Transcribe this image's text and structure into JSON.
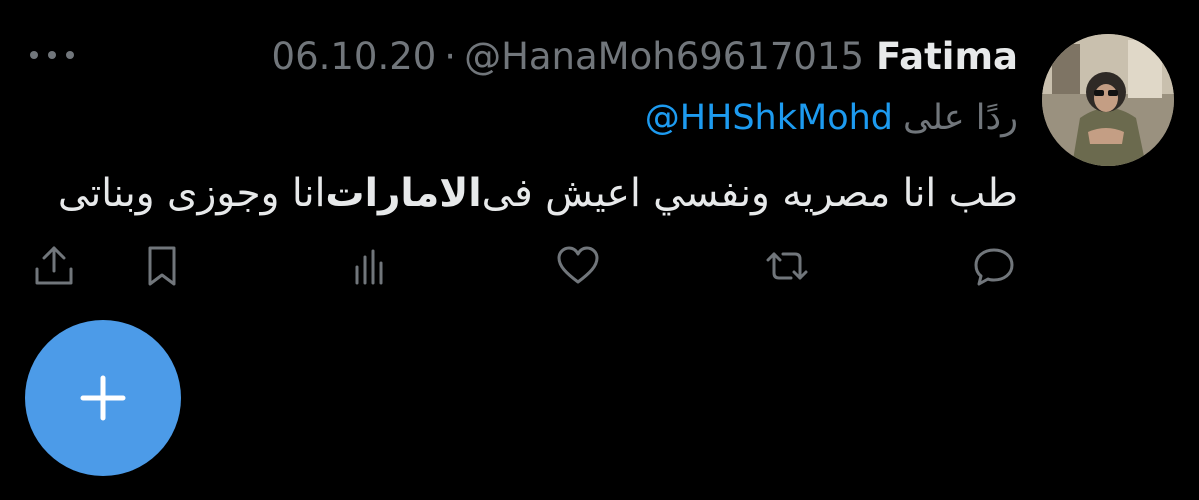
{
  "tweet": {
    "author_name": "Fatima",
    "handle": "@HanaMoh69617015",
    "separator": "·",
    "date": "06.10.20",
    "reply_prefix": "ردًا على",
    "reply_mention": "@HHShkMohd",
    "text_before": "طب انا مصريه ونفسي اعيش فى ",
    "text_bold": "الامارات",
    "text_after": " انا وجوزى وبناتى"
  },
  "actions": [
    {
      "name": "reply",
      "icon": "reply-icon"
    },
    {
      "name": "retweet",
      "icon": "retweet-icon"
    },
    {
      "name": "like",
      "icon": "heart-icon"
    },
    {
      "name": "analytics",
      "icon": "analytics-icon"
    },
    {
      "name": "bookmark",
      "icon": "bookmark-icon"
    },
    {
      "name": "share",
      "icon": "share-icon"
    }
  ],
  "colors": {
    "background": "#000000",
    "text": "#e7e9ea",
    "muted": "#71767b",
    "link": "#1d9bf0",
    "fab": "#4c9be8"
  }
}
